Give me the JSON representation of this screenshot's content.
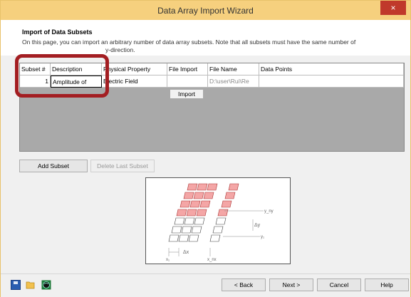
{
  "window": {
    "title": "Data Array Import Wizard",
    "close_label": "×"
  },
  "header": {
    "title": "Import of Data Subsets",
    "description_line1": "On this page, you can import an arbitrary number of data array subsets. Note that all subsets must have the same number of",
    "description_line2_visible": "y-direction."
  },
  "grid": {
    "columns": [
      "Subset #",
      "Description",
      "Physical Property",
      "File Import",
      "File Name",
      "Data Points"
    ],
    "rows": [
      {
        "subset_number": "1",
        "description": "Amplitude of",
        "physical_property": "Electric Field",
        "file_import": "Import",
        "file_name": "D:\\user\\Rui\\Re",
        "data_points": ""
      }
    ]
  },
  "buttons": {
    "add_subset": "Add Subset",
    "delete_last_subset": "Delete Last Subset",
    "back": "< Back",
    "next": "Next >",
    "cancel": "Cancel",
    "help": "Help"
  },
  "diagram": {
    "labels": [
      "Δy",
      "Δx",
      "x₁",
      "y₁",
      "x_nx",
      "y_ny"
    ]
  },
  "icons": {
    "save": "save-icon",
    "open": "open-folder-icon",
    "globe": "globe-icon"
  },
  "colors": {
    "titlebar": "#f6d07e",
    "highlight": "#a31e22",
    "red_cells": "#f4a6a6"
  }
}
